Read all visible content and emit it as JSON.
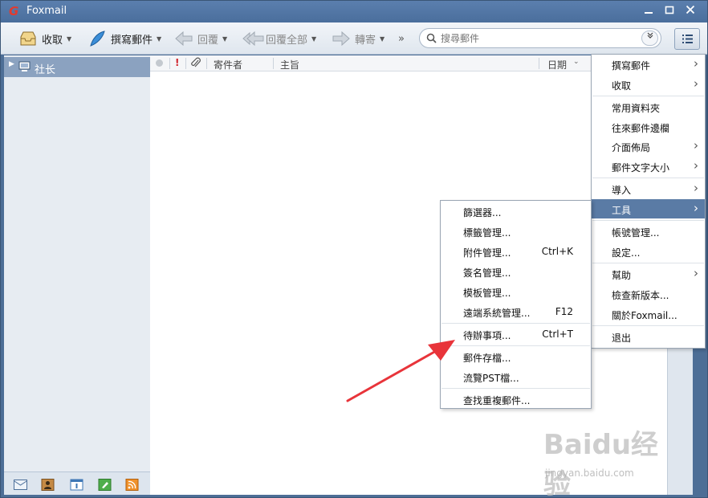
{
  "window": {
    "title": "Foxmail",
    "logo_glyph": "G"
  },
  "toolbar": {
    "receive": "收取",
    "compose": "撰寫郵件",
    "reply": "回覆",
    "reply_all": "回覆全部",
    "forward": "轉寄",
    "more": "»",
    "search_placeholder": "搜尋郵件"
  },
  "sidebar": {
    "account": "社长"
  },
  "list_header": {
    "sender": "寄件者",
    "subject": "主旨",
    "date": "日期"
  },
  "main_menu": {
    "items": [
      {
        "label": "撰寫郵件",
        "has_submenu": true
      },
      {
        "label": "收取",
        "has_submenu": true
      },
      {
        "label": "常用資料夾",
        "has_submenu": false
      },
      {
        "label": "往來郵件邊欄",
        "has_submenu": false
      },
      {
        "label": "介面佈局",
        "has_submenu": true
      },
      {
        "label": "郵件文字大小",
        "has_submenu": true
      },
      {
        "label": "導入",
        "has_submenu": true
      },
      {
        "label": "工具",
        "has_submenu": true,
        "active": true
      },
      {
        "label": "帳號管理...",
        "has_submenu": false
      },
      {
        "label": "設定...",
        "has_submenu": false
      },
      {
        "label": "幫助",
        "has_submenu": true
      },
      {
        "label": "檢查新版本...",
        "has_submenu": false
      },
      {
        "label": "關於Foxmail...",
        "has_submenu": false
      },
      {
        "label": "退出",
        "has_submenu": false
      }
    ]
  },
  "tools_menu": {
    "items": [
      {
        "label": "篩選器...",
        "shortcut": ""
      },
      {
        "label": "標籤管理...",
        "shortcut": ""
      },
      {
        "label": "附件管理...",
        "shortcut": "Ctrl+K"
      },
      {
        "label": "簽名管理...",
        "shortcut": ""
      },
      {
        "label": "模板管理...",
        "shortcut": ""
      },
      {
        "label": "遠端系統管理...",
        "shortcut": "F12"
      },
      {
        "label": "待辦事項...",
        "shortcut": "Ctrl+T"
      },
      {
        "label": "郵件存檔...",
        "shortcut": ""
      },
      {
        "label": "流覽PST檔...",
        "shortcut": ""
      },
      {
        "label": "查找重複郵件...",
        "shortcut": ""
      }
    ]
  },
  "watermark": {
    "main": "Baidu经验",
    "sub": "jingyan.baidu.com"
  },
  "colors": {
    "accent": "#5a7ba5",
    "annotation_arrow": "#e8343a",
    "logo": "#e23a2e"
  }
}
